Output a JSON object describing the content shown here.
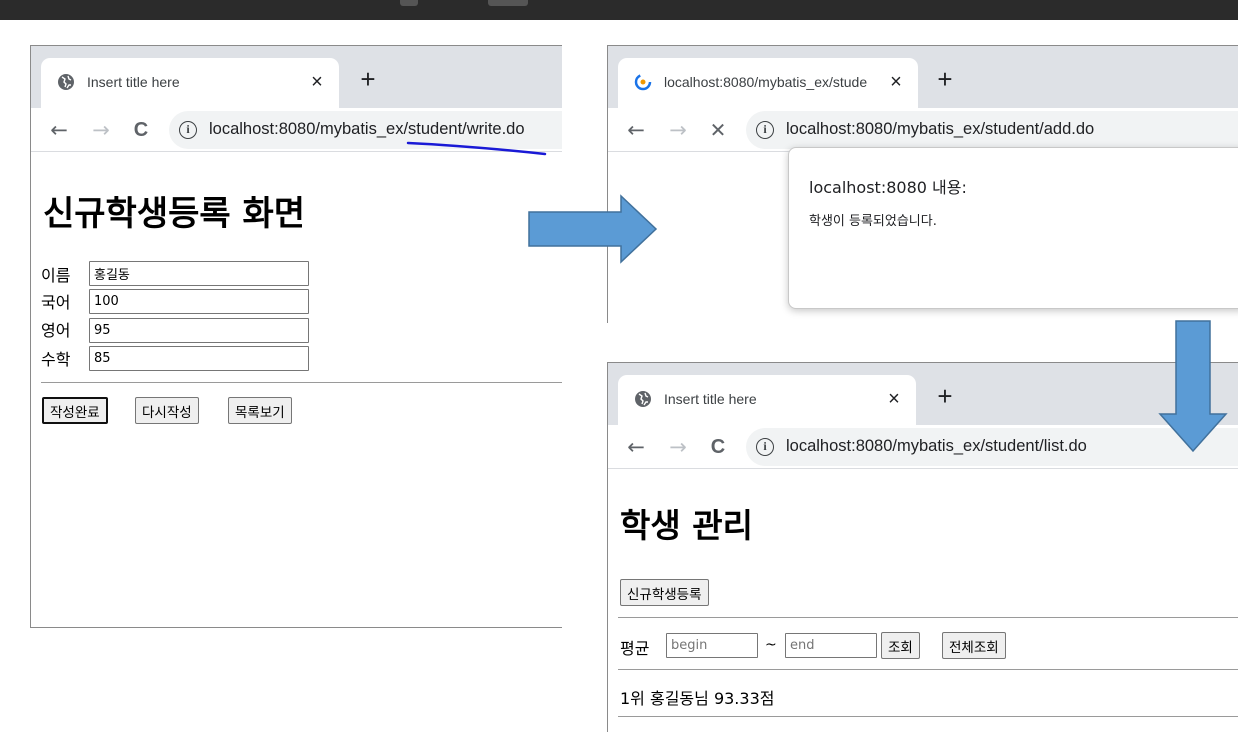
{
  "colors": {
    "tab_strip": "#dee1e6",
    "arrow_fill": "#5b9bd5",
    "arrow_stroke": "#41719c",
    "annotation_underline": "#1a1ad6"
  },
  "window_write": {
    "tab_title": "Insert title here",
    "tab_icon": "globe-icon",
    "url": "localhost:8080/mybatis_ex/student/write.do",
    "heading": "신규학생등록 화면",
    "fields": [
      {
        "label": "이름",
        "value": "홍길동"
      },
      {
        "label": "국어",
        "value": "100"
      },
      {
        "label": "영어",
        "value": "95"
      },
      {
        "label": "수학",
        "value": "85"
      }
    ],
    "buttons": {
      "submit": "작성완료",
      "reset": "다시작성",
      "list": "목록보기"
    }
  },
  "window_add": {
    "tab_title": "localhost:8080/mybatis_ex/stude",
    "tab_icon": "loading-spinner-icon",
    "url": "localhost:8080/mybatis_ex/student/add.do",
    "alert": {
      "title": "localhost:8080 내용:",
      "message": "학생이 등록되었습니다."
    }
  },
  "window_list": {
    "tab_title": "Insert title here",
    "tab_icon": "globe-icon",
    "url": "localhost:8080/mybatis_ex/student/list.do",
    "heading": "학생 관리",
    "register_button": "신규학생등록",
    "filter": {
      "label": "평균",
      "begin_placeholder": "begin",
      "separator": "~",
      "end_placeholder": "end",
      "search_button": "조회",
      "all_button": "전체조회"
    },
    "results": [
      "1위 홍길동님 93.33점"
    ]
  },
  "browser_chrome": {
    "close_glyph": "×",
    "new_tab_glyph": "+",
    "back_glyph": "←",
    "forward_glyph": "→",
    "reload_glyph": "C",
    "stop_glyph": "✕",
    "info_glyph": "i"
  }
}
